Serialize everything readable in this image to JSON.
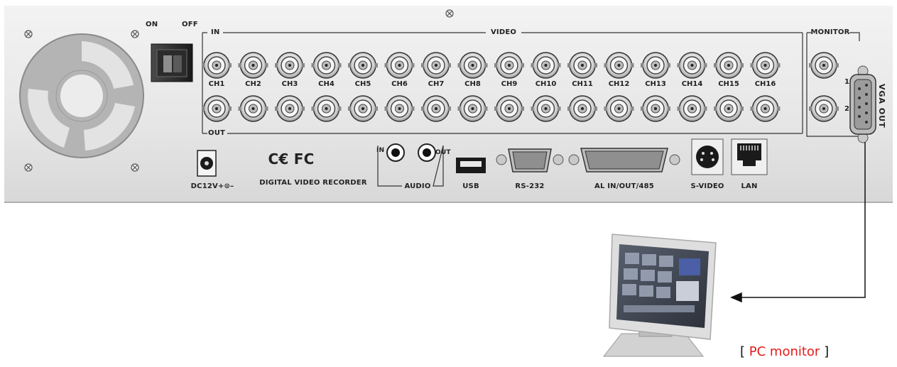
{
  "panel": {
    "switch": {
      "on_label": "ON",
      "off_label": "OFF"
    },
    "video": {
      "in_label": "IN",
      "title": "VIDEO",
      "out_label": "OUT",
      "channels": [
        "CH1",
        "CH2",
        "CH3",
        "CH4",
        "CH5",
        "CH6",
        "CH7",
        "CH8",
        "CH9",
        "CH10",
        "CH11",
        "CH12",
        "CH13",
        "CH14",
        "CH15",
        "CH16"
      ]
    },
    "monitor": {
      "title": "MONITOR",
      "ports": [
        "1",
        "2"
      ]
    },
    "vga_label": "VGA OUT",
    "power_label": "DC12V+⊙–",
    "certifications": "C€ FC",
    "product_name": "DIGITAL VIDEO RECORDER",
    "audio": {
      "title": "AUDIO",
      "in_label": "IN",
      "out_label": "OUT"
    },
    "usb_label": "USB",
    "rs232_label": "RS-232",
    "alarm_label": "AL IN/OUT/485",
    "svideo_label": "S-VIDEO",
    "lan_label": "LAN"
  },
  "caption": {
    "open": "[",
    "text": "PC monitor",
    "close": "]",
    "highlight_color": "#e31b1b"
  }
}
